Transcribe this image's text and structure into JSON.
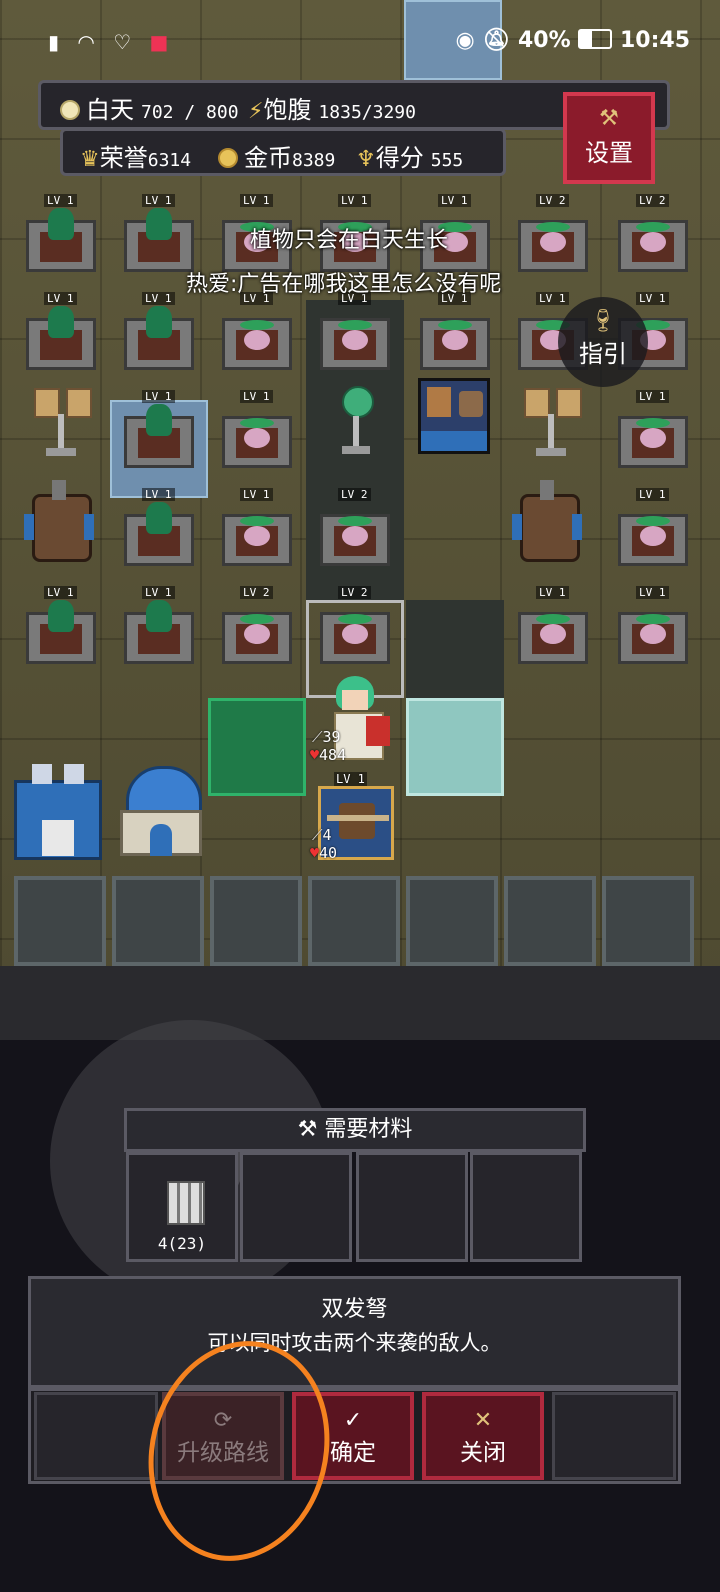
{
  "status_bar": {
    "left_icons": [
      "alert-icon",
      "wifi-icon",
      "heart-icon",
      "app-icon"
    ],
    "eye_icon": "eye-icon",
    "mute_icon": "bell-off-icon",
    "battery": "40%",
    "time": "10:45"
  },
  "hud": {
    "day_label": "白天",
    "day_value": "702 / 800",
    "hunger_label": "饱腹",
    "hunger_value": "1835/3290",
    "honor_label": "荣誉",
    "honor_value": "6314",
    "gold_label": "金币",
    "gold_value": "8389",
    "score_label": "得分",
    "score_value": "555",
    "settings_label": "设置",
    "guide_label": "指引"
  },
  "messages": {
    "tip": "植物只会在白天生长",
    "chat": "热爱:广告在哪我这里怎么没有呢"
  },
  "hero": {
    "attack": "39",
    "hp": "484"
  },
  "crossbow": {
    "level": "LV 1",
    "attack": "4",
    "hp": "40"
  },
  "plants": [
    {
      "lv": "LV 1",
      "kind": "tree"
    },
    {
      "lv": "LV 1",
      "kind": "tree"
    },
    {
      "lv": "LV 1",
      "kind": "bulb"
    },
    {
      "lv": "LV 1",
      "kind": "bulb"
    },
    {
      "lv": "LV 1",
      "kind": "bulb"
    },
    {
      "lv": "LV 2",
      "kind": "bulb"
    },
    {
      "lv": "LV 2",
      "kind": "bulb"
    },
    {
      "lv": "LV 1",
      "kind": "tree"
    },
    {
      "lv": "LV 1",
      "kind": "tree"
    },
    {
      "lv": "LV 1",
      "kind": "bulb"
    },
    {
      "lv": "LV 1",
      "kind": "bulb"
    },
    {
      "lv": "LV 1",
      "kind": "bulb"
    },
    {
      "lv": "LV 1",
      "kind": "bulb"
    },
    {
      "lv": "LV 1",
      "kind": "bulb"
    },
    {
      "lv": "LV 1",
      "kind": "tree"
    },
    {
      "lv": "LV 1",
      "kind": "bulb"
    },
    {
      "lv": "LV 1",
      "kind": "bulb"
    },
    {
      "lv": "LV 1",
      "kind": "tree"
    },
    {
      "lv": "LV 1",
      "kind": "bulb"
    },
    {
      "lv": "LV 2",
      "kind": "bulb"
    },
    {
      "lv": "LV 1",
      "kind": "bulb"
    },
    {
      "lv": "LV 1",
      "kind": "tree"
    },
    {
      "lv": "LV 1",
      "kind": "tree"
    },
    {
      "lv": "LV 2",
      "kind": "bulb"
    },
    {
      "lv": "LV 2",
      "kind": "bulb"
    },
    {
      "lv": "LV 1",
      "kind": "bulb"
    },
    {
      "lv": "LV 1",
      "kind": "bulb"
    }
  ],
  "materials": {
    "title": "需要材料",
    "items": [
      {
        "icon": "pillar-icon",
        "qty": "4(23)"
      }
    ]
  },
  "info": {
    "name": "双发弩",
    "desc": "可以同时攻击两个来袭的敌人。"
  },
  "buttons": {
    "upgrade_route": "升级路线",
    "confirm": "确定",
    "close": "关闭"
  },
  "colors": {
    "accent_red": "#b02a3e",
    "annotation": "#f5821f"
  }
}
